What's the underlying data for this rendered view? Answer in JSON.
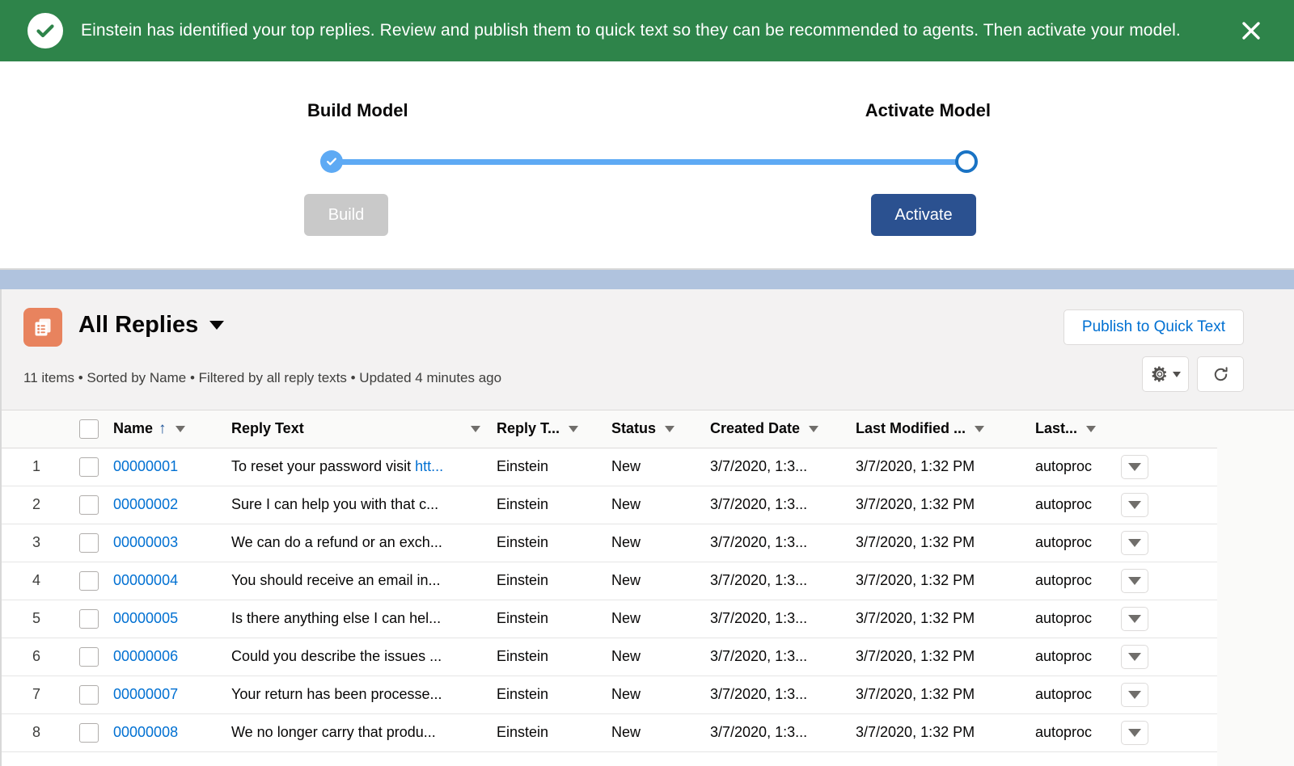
{
  "banner": {
    "icon": "check-circle-icon",
    "message": "Einstein has identified your top replies. Review and publish them to quick text so they can be recommended to agents. Then activate your model.",
    "close_icon": "close-icon",
    "background_color": "#2e844a"
  },
  "stepper": {
    "steps": [
      {
        "label": "Build Model",
        "state": "completed"
      },
      {
        "label": "Activate Model",
        "state": "current"
      }
    ],
    "buttons": {
      "build_label": "Build",
      "build_state": "disabled",
      "activate_label": "Activate",
      "activate_state": "enabled",
      "activate_color": "#2b5190"
    },
    "track_color": "#5eaaf4"
  },
  "listview": {
    "icon": "reply-records-icon",
    "icon_color": "#e8835e",
    "title": "All Replies",
    "title_caret": "chevron-down-icon",
    "meta": "11 items • Sorted by Name • Filtered by all reply texts • Updated 4 minutes ago",
    "publish_button": "Publish to Quick Text",
    "settings_icon": "gear-icon",
    "refresh_icon": "refresh-icon"
  },
  "table": {
    "select_all_checkbox": "select-all",
    "columns": [
      {
        "key": "name",
        "label": "Name",
        "sorted": "asc"
      },
      {
        "key": "reply",
        "label": "Reply Text",
        "sorted": ""
      },
      {
        "key": "rtype",
        "label": "Reply T...",
        "sorted": ""
      },
      {
        "key": "status",
        "label": "Status",
        "sorted": ""
      },
      {
        "key": "created",
        "label": "Created Date",
        "sorted": ""
      },
      {
        "key": "modified",
        "label": "Last Modified ...",
        "sorted": ""
      },
      {
        "key": "lastby",
        "label": "Last...",
        "sorted": ""
      }
    ],
    "rows": [
      {
        "num": "1",
        "name": "00000001",
        "reply": "To reset your password visit ",
        "reply_link": "htt...",
        "rtype": "Einstein",
        "status": "New",
        "created": "3/7/2020, 1:3...",
        "modified": "3/7/2020, 1:32 PM",
        "lastby": "autoproc"
      },
      {
        "num": "2",
        "name": "00000002",
        "reply": "Sure I can help you with that c...",
        "reply_link": "",
        "rtype": "Einstein",
        "status": "New",
        "created": "3/7/2020, 1:3...",
        "modified": "3/7/2020, 1:32 PM",
        "lastby": "autoproc"
      },
      {
        "num": "3",
        "name": "00000003",
        "reply": "We can do a refund or an exch...",
        "reply_link": "",
        "rtype": "Einstein",
        "status": "New",
        "created": "3/7/2020, 1:3...",
        "modified": "3/7/2020, 1:32 PM",
        "lastby": "autoproc"
      },
      {
        "num": "4",
        "name": "00000004",
        "reply": "You should receive an email in...",
        "reply_link": "",
        "rtype": "Einstein",
        "status": "New",
        "created": "3/7/2020, 1:3...",
        "modified": "3/7/2020, 1:32 PM",
        "lastby": "autoproc"
      },
      {
        "num": "5",
        "name": "00000005",
        "reply": "Is there anything else I can hel...",
        "reply_link": "",
        "rtype": "Einstein",
        "status": "New",
        "created": "3/7/2020, 1:3...",
        "modified": "3/7/2020, 1:32 PM",
        "lastby": "autoproc"
      },
      {
        "num": "6",
        "name": "00000006",
        "reply": "Could you describe the issues ...",
        "reply_link": "",
        "rtype": "Einstein",
        "status": "New",
        "created": "3/7/2020, 1:3...",
        "modified": "3/7/2020, 1:32 PM",
        "lastby": "autoproc"
      },
      {
        "num": "7",
        "name": "00000007",
        "reply": "Your return has been processe...",
        "reply_link": "",
        "rtype": "Einstein",
        "status": "New",
        "created": "3/7/2020, 1:3...",
        "modified": "3/7/2020, 1:32 PM",
        "lastby": "autoproc"
      },
      {
        "num": "8",
        "name": "00000008",
        "reply": "We no longer carry that produ...",
        "reply_link": "",
        "rtype": "Einstein",
        "status": "New",
        "created": "3/7/2020, 1:3...",
        "modified": "3/7/2020, 1:32 PM",
        "lastby": "autoproc"
      }
    ],
    "row_action_icon": "chevron-down-icon"
  }
}
